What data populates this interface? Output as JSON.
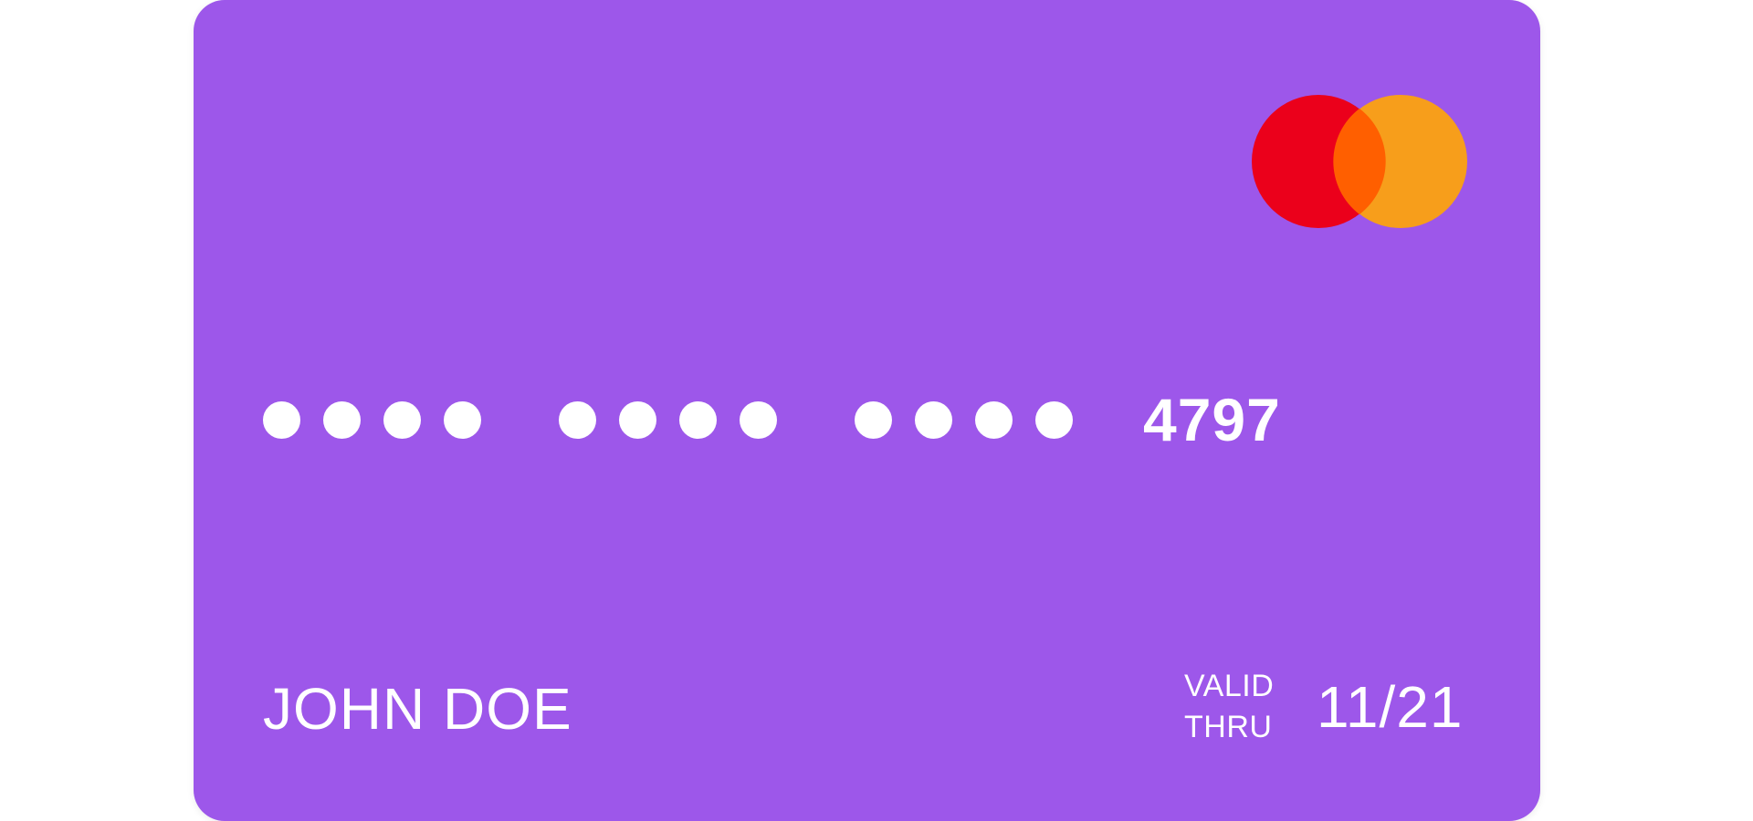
{
  "card": {
    "background_color": "#9d57ea",
    "brand": {
      "name": "mastercard-logo-icon",
      "colors": {
        "left": "#eb001b",
        "right": "#f79e1b",
        "overlap": "#ff5f00"
      }
    },
    "number": {
      "masked_groups": 3,
      "digits_per_group": 4,
      "last4": "4797"
    },
    "holder_name": "JOHN DOE",
    "validity": {
      "label_line1": "VALID",
      "label_line2": "THRU",
      "expiry": "11/21"
    }
  }
}
